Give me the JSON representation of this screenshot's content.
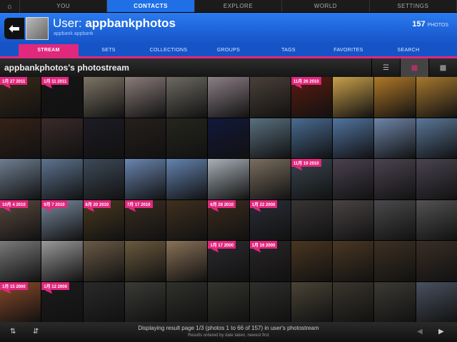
{
  "topnav": {
    "home_icon": "home-icon",
    "tabs": [
      {
        "label": "YOU",
        "active": false
      },
      {
        "label": "CONTACTS",
        "active": true
      },
      {
        "label": "EXPLORE",
        "active": false
      },
      {
        "label": "WORLD",
        "active": false
      },
      {
        "label": "SETTINGS",
        "active": false
      }
    ]
  },
  "header": {
    "title_prefix": "User: ",
    "username": "appbankphotos",
    "subtitle": "appbank appbank",
    "count": "157",
    "count_unit": "PHOTOS"
  },
  "subnav": [
    {
      "label": "STREAM",
      "active": true
    },
    {
      "label": "SETS"
    },
    {
      "label": "COLLECTIONS"
    },
    {
      "label": "GROUPS"
    },
    {
      "label": "TAGS"
    },
    {
      "label": "FAVORITES"
    },
    {
      "label": "SEARCH"
    }
  ],
  "section": {
    "title": "appbankphotos's photostream"
  },
  "view_modes": [
    "list-view-icon",
    "grid-view-icon",
    "mosaic-view-icon"
  ],
  "colors": {
    "accent_pink": "#e0287d",
    "blue": "#1f6fe6"
  },
  "photos": [
    {
      "c": "#3a2a18",
      "d": "1月 27 2011"
    },
    {
      "c": "#151515",
      "d": "1月 11 2011"
    },
    {
      "c": "#7d7565"
    },
    {
      "c": "#8a7c7a"
    },
    {
      "c": "#6e6a62"
    },
    {
      "c": "#8c7f86"
    },
    {
      "c": "#4a4038"
    },
    {
      "c": "#5b1c10",
      "d": "11月 26 2010"
    },
    {
      "c": "#c9a04a"
    },
    {
      "c": "#b07828"
    },
    {
      "c": "#a7782e"
    },
    {
      "c": "#352218"
    },
    {
      "c": "#3a2a2a"
    },
    {
      "c": "#1c1c24"
    },
    {
      "c": "#26201c"
    },
    {
      "c": "#26261e"
    },
    {
      "c": "#12183a"
    },
    {
      "c": "#5a7080"
    },
    {
      "c": "#4a6c92"
    },
    {
      "c": "#5274a0"
    },
    {
      "c": "#6e86a8"
    },
    {
      "c": "#5a7898"
    },
    {
      "c": "#6e7e90"
    },
    {
      "c": "#5e7490"
    },
    {
      "c": "#3e4a58"
    },
    {
      "c": "#6a86b0"
    },
    {
      "c": "#6484b0"
    },
    {
      "c": "#a8b0b8"
    },
    {
      "c": "#7a6e60"
    },
    {
      "c": "#3a4650",
      "d": "11月 19 2010"
    },
    {
      "c": "#4a4250"
    },
    {
      "c": "#4c4450"
    },
    {
      "c": "#4a4450"
    },
    {
      "c": "#5a4a40",
      "d": "10月 4 2010"
    },
    {
      "c": "#7a8a9e",
      "d": "9月 7 2010"
    },
    {
      "c": "#4a3a20",
      "d": "8月 20 2010"
    },
    {
      "c": "#3a2e22",
      "d": "7月 17 2010"
    },
    {
      "c": "#403020"
    },
    {
      "c": "#3c2c20",
      "d": "6月 28 2010"
    },
    {
      "c": "#2a2e38",
      "d": "1月 22 2000"
    },
    {
      "c": "#383434"
    },
    {
      "c": "#4a4444"
    },
    {
      "c": "#4a4a4c"
    },
    {
      "c": "#545252"
    },
    {
      "c": "#7a7a7a"
    },
    {
      "c": "#9a9a9a"
    },
    {
      "c": "#6a5a46"
    },
    {
      "c": "#6a5a3e"
    },
    {
      "c": "#8a7258"
    },
    {
      "c": "#2c2a2e",
      "d": "1月 17 2000"
    },
    {
      "c": "#2a2628",
      "d": "1月 16 2000"
    },
    {
      "c": "#4a3620"
    },
    {
      "c": "#4a3824"
    },
    {
      "c": "#3e3024"
    },
    {
      "c": "#3a2e26"
    },
    {
      "c": "#8a4a2a",
      "d": "1月 15 2000"
    },
    {
      "c": "#1c1c1c",
      "d": "1月 12 2000"
    },
    {
      "c": "#2a2a2a"
    },
    {
      "c": "#3a3a36"
    },
    {
      "c": "#30302c"
    },
    {
      "c": "#34342e"
    },
    {
      "c": "#2e2e2c"
    },
    {
      "c": "#4a4436"
    },
    {
      "c": "#3a362e"
    },
    {
      "c": "#3c3a34"
    },
    {
      "c": "#4a5260"
    }
  ],
  "footer": {
    "line1": "Displaying result page 1/3 (photos 1 to 66 of 157) in user's photostream",
    "line2": "Results ordered by date taken, newest first",
    "icons": [
      "refresh-icon",
      "sort-icon",
      "prev-icon",
      "next-icon"
    ]
  }
}
